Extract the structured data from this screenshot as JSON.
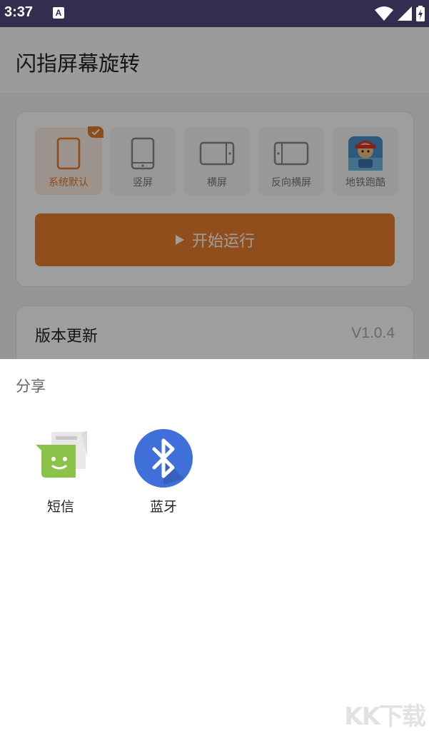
{
  "status_bar": {
    "time": "3:37",
    "notification_glyph": "A"
  },
  "app": {
    "title": "闪指屏幕旋转",
    "accent_color": "#e87e2e",
    "modes": [
      {
        "label": "系统默认",
        "icon": "phone-outline-icon",
        "selected": true
      },
      {
        "label": "竖屏",
        "icon": "portrait-phone-icon",
        "selected": false
      },
      {
        "label": "横屏",
        "icon": "landscape-phone-icon",
        "selected": false
      },
      {
        "label": "反向横屏",
        "icon": "reverse-landscape-phone-icon",
        "selected": false
      },
      {
        "label": "地铁跑酷",
        "icon": "subway-surfers-app-icon",
        "selected": false
      }
    ],
    "start_button_label": "开始运行",
    "version_label": "版本更新",
    "version_value": "V1.0.4"
  },
  "share_sheet": {
    "title": "分享",
    "items": [
      {
        "label": "短信",
        "icon": "messaging-app-icon"
      },
      {
        "label": "蓝牙",
        "icon": "bluetooth-icon"
      }
    ]
  },
  "watermark": "KK下载"
}
